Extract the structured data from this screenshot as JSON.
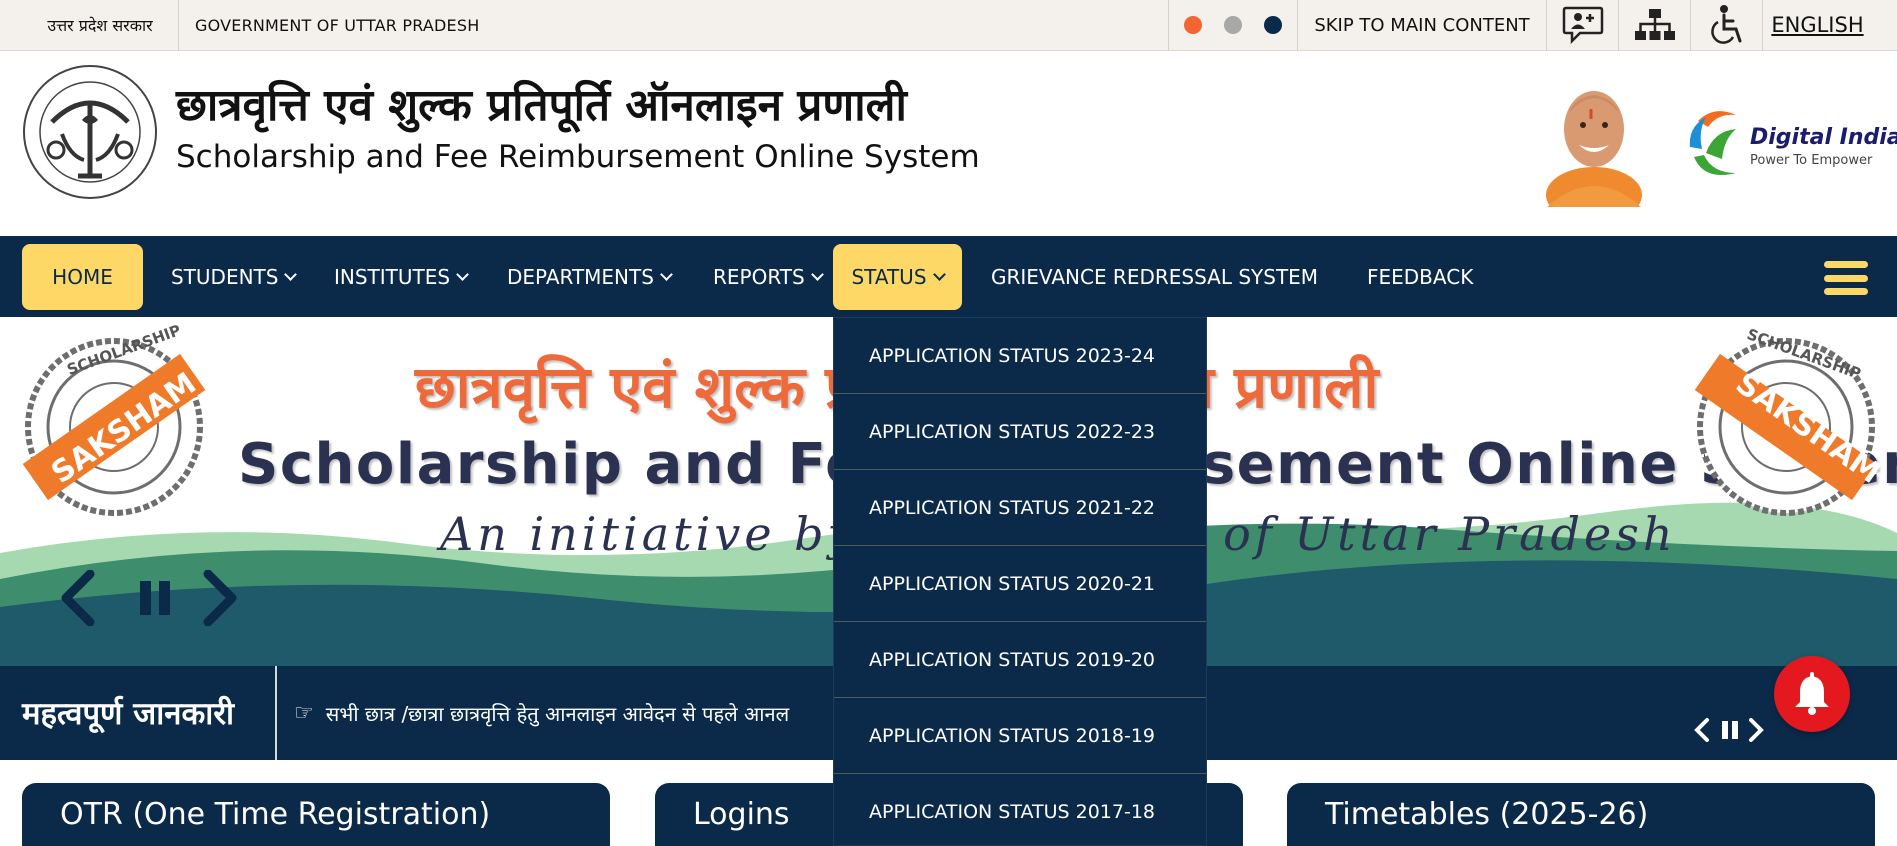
{
  "topbar": {
    "gov_hindi": "उत्तर प्रदेश सरकार",
    "gov_english": "GOVERNMENT OF UTTAR PRADESH",
    "theme_colors": [
      "#f26532",
      "#a8a8a8",
      "#0b2a4a"
    ],
    "skip_label": "SKIP TO MAIN CONTENT",
    "icons": [
      "chat-user-icon",
      "sitemap-icon",
      "accessibility-icon"
    ],
    "language_label": "ENGLISH"
  },
  "header": {
    "title_hindi": "छात्रवृत्ति एवं शुल्क प्रतिपूर्ति ऑनलाइन प्रणाली",
    "title_english": "Scholarship and Fee Reimbursement Online System",
    "digital_india": {
      "name": "Digital India",
      "tagline": "Power To Empower"
    }
  },
  "nav": {
    "items": [
      {
        "label": "HOME",
        "dropdown": false,
        "active": true
      },
      {
        "label": "STUDENTS",
        "dropdown": true
      },
      {
        "label": "INSTITUTES",
        "dropdown": true
      },
      {
        "label": "DEPARTMENTS",
        "dropdown": true
      },
      {
        "label": "REPORTS",
        "dropdown": true
      },
      {
        "label": "STATUS",
        "dropdown": true,
        "active": true
      },
      {
        "label": "GRIEVANCE REDRESSAL SYSTEM",
        "dropdown": false
      },
      {
        "label": "FEEDBACK",
        "dropdown": false
      }
    ],
    "menu_icon": "hamburger-menu-icon",
    "accent_color": "#fdd867",
    "bg_color": "#0b2a4a"
  },
  "status_dropdown": {
    "items": [
      "APPLICATION STATUS 2023-24",
      "APPLICATION STATUS 2022-23",
      "APPLICATION STATUS 2021-22",
      "APPLICATION STATUS 2020-21",
      "APPLICATION STATUS 2019-20",
      "APPLICATION STATUS 2018-19",
      "APPLICATION STATUS 2017-18"
    ]
  },
  "banner": {
    "title_hindi": "छात्रवृत्ति एवं शुल्क प्रतिपूर्ति ऑनलाइन प्रणाली",
    "title_english": "Scholarship and Fee Reimbursement Online System",
    "tagline": "An initiative by Government of Uttar Pradesh",
    "stamp_text": {
      "main": "SAKSHAM",
      "ring": "SCHOLARSHIP"
    },
    "controls": [
      "prev-icon",
      "pause-icon",
      "next-icon"
    ]
  },
  "ticker": {
    "title": "महत्वपूर्ण जानकारी",
    "text": "सभी छात्र /छात्रा छात्रवृत्ति हेतु आनलाइन आवेदन से पहले आनल",
    "controls": [
      "prev-icon",
      "pause-icon",
      "next-icon"
    ]
  },
  "cards": [
    {
      "title": "OTR (One Time Registration)"
    },
    {
      "title": "Logins"
    },
    {
      "title": "Timetables (2025-26)"
    }
  ]
}
